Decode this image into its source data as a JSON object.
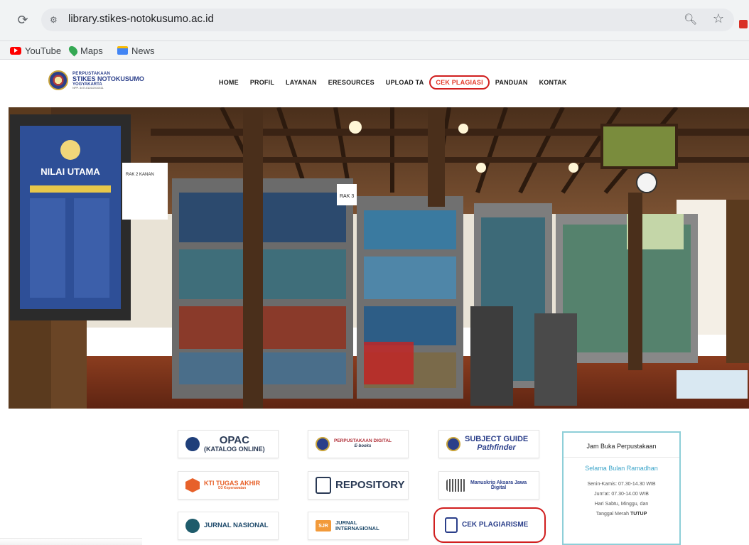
{
  "browser": {
    "url": "library.stikes-notokusumo.ac.id",
    "bookmarks": [
      {
        "label": "YouTube",
        "icon": "youtube-icon"
      },
      {
        "label": "Maps",
        "icon": "maps-icon"
      },
      {
        "label": "News",
        "icon": "news-icon"
      }
    ]
  },
  "site": {
    "logo": {
      "line1": "PERPUSTAKAAN",
      "line2": "STIKES NOTOKUSUMO",
      "line3": "YOGYAKARTA",
      "line4": "NPP. 3471012D2010311"
    },
    "nav": [
      "HOME",
      "PROFIL",
      "LAYANAN",
      "ERESOURCES",
      "UPLOAD TA",
      "CEK PLAGIASI",
      "PANDUAN",
      "KONTAK"
    ],
    "hero": {
      "board_title": "NILAI UTAMA",
      "rack_label_1": "RAK 2 KANAN",
      "rack_label_2": "RAK 3"
    }
  },
  "quicklinks": {
    "opac": {
      "line1": "OPAC",
      "line2": "(KATALOG ONLINE)"
    },
    "perpus_digital": {
      "line1": "PERPUSTAKAAN DIGITAL",
      "line2": "E-books"
    },
    "subject_guide": {
      "line1": "SUBJECT GUIDE",
      "line2": "Pathfinder"
    },
    "kti": {
      "line1": "KTI TUGAS AKHIR",
      "line2": "D3 Keperawatan"
    },
    "repository": {
      "line1": "REPOSITORY"
    },
    "manuskrip": {
      "line1": "Manuskrip Aksara Jawa",
      "line2": "Digital"
    },
    "jurnal_nasional": {
      "line1": "JURNAL NASIONAL"
    },
    "jurnal_internasional": {
      "badge": "SJR",
      "line1": "JURNAL INTERNASIONAL"
    },
    "cek_plagiarisme": {
      "line1": "CEK PLAGIARISME"
    }
  },
  "hours": {
    "title": "Jam Buka Perpustakaan",
    "subtitle": "Selama Bulan Ramadhan",
    "line1": "Senin-Kamis: 07.30-14.30 WIB",
    "line2": "Jum'at: 07.30-14.00 WIB",
    "line3": "Hari Sabtu, Minggu, dan",
    "line4_prefix": "Tanggal Merah ",
    "line4_bold": "TUTUP"
  },
  "colors": {
    "accent_red": "#d11f1f",
    "nav_text": "#1a1a1a",
    "hours_border": "#8ecfd8",
    "ramadhan_text": "#3aa4c9"
  }
}
